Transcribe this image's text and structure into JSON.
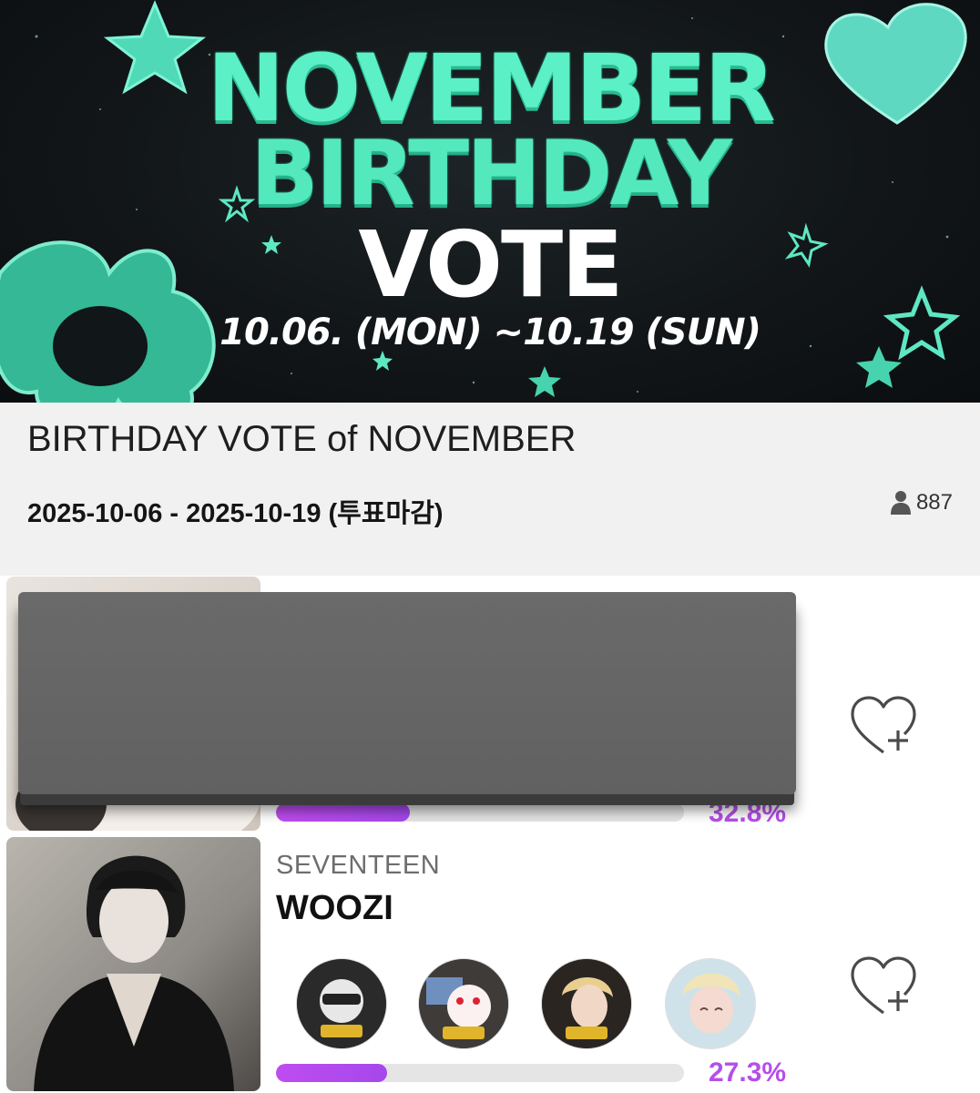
{
  "banner": {
    "line1": "NOVEMBER",
    "line2": "BIRTHDAY",
    "line3": "VOTE",
    "dates": "10.06. (MON) ~10.19 (SUN)"
  },
  "vote": {
    "title": "BIRTHDAY VOTE of NOVEMBER",
    "period": "2025-10-06 - 2025-10-19 (투표마감)",
    "participants": "887"
  },
  "candidates": [
    {
      "group": "",
      "name": "",
      "percent_label": "32.8%",
      "percent": 32.8
    },
    {
      "group": "SEVENTEEN",
      "name": "WOOZI",
      "percent_label": "27.3%",
      "percent": 27.3
    }
  ],
  "colors": {
    "accent": "#b64ee9",
    "banner_text": "#5cf0c6",
    "panel_bg": "#f1f1f1"
  },
  "icons": [
    "person-icon",
    "heart-plus-icon",
    "star-icon",
    "heart-icon"
  ]
}
